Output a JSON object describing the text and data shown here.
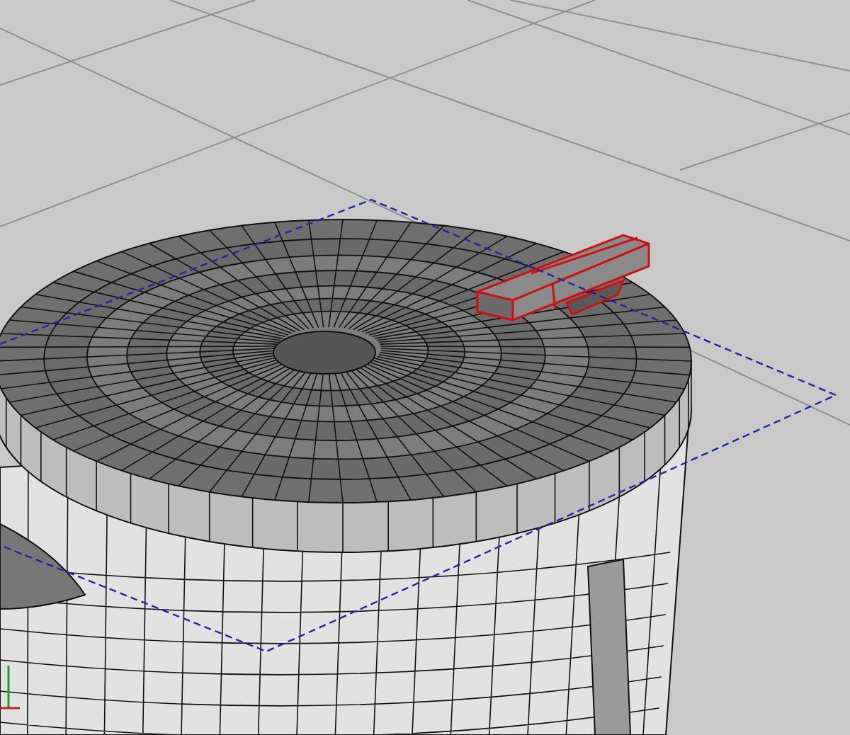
{
  "viewport": {
    "objects": [
      {
        "kind": "cup",
        "selected": false
      },
      {
        "kind": "lid",
        "selected": false
      },
      {
        "kind": "clip",
        "selected": true
      }
    ]
  }
}
